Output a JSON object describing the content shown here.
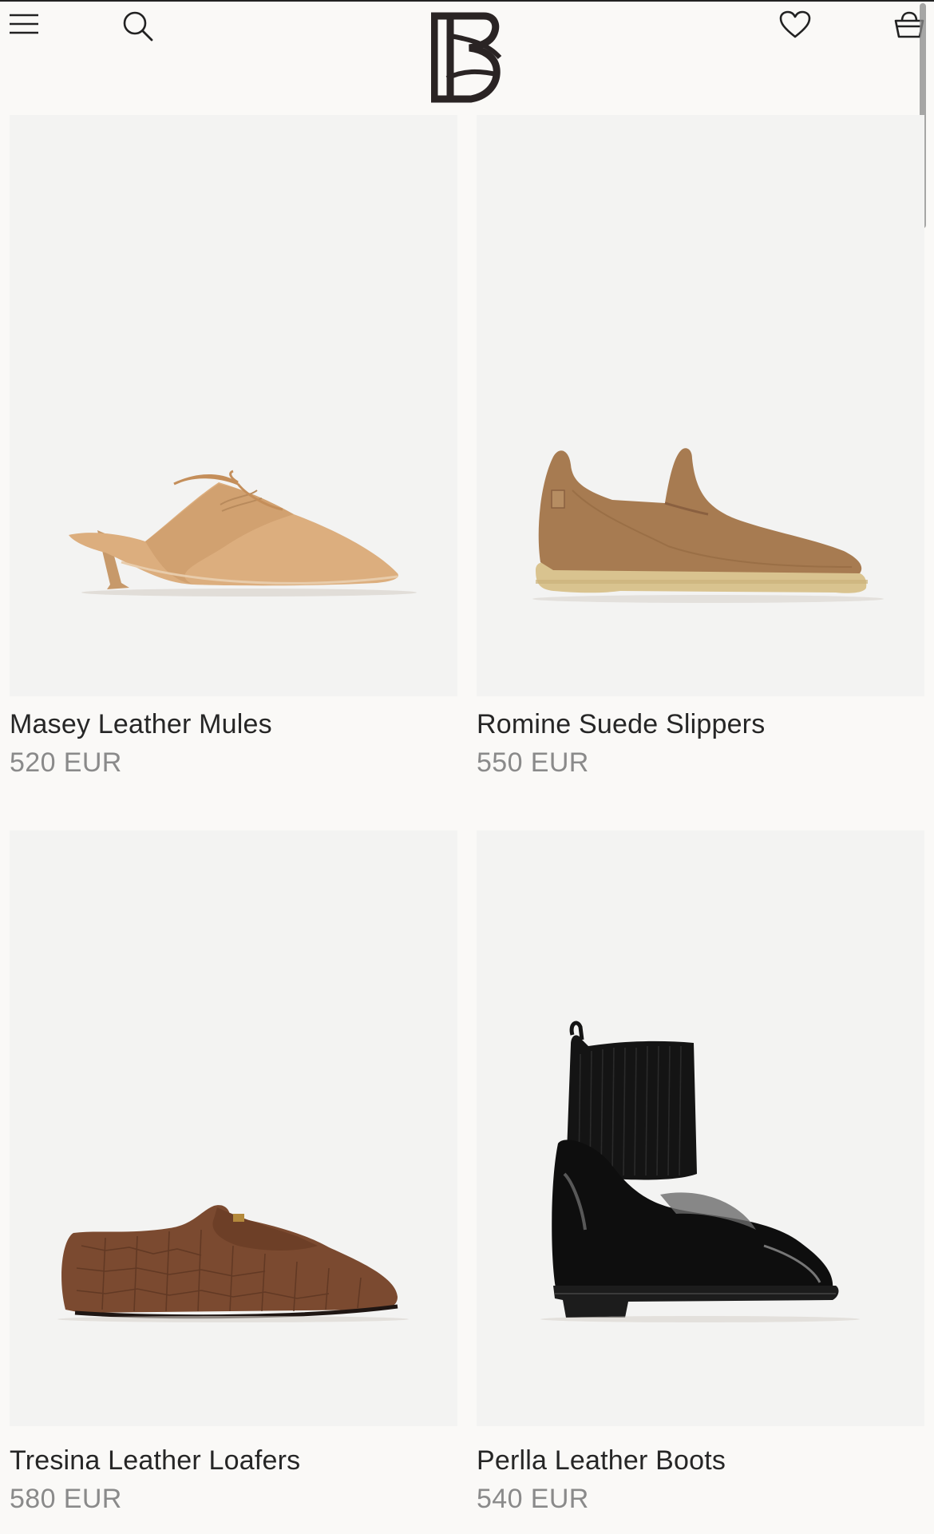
{
  "header": {
    "menu_icon": "hamburger-menu-icon",
    "search_icon": "search-icon",
    "logo": "brand-monogram-logo",
    "wishlist_icon": "heart-icon",
    "bag_icon": "shopping-bag-icon"
  },
  "products": [
    {
      "name": "Masey Leather Mules",
      "price": "520 EUR",
      "image": "tan-leather-kitten-heel-mule"
    },
    {
      "name": "Romine Suede Slippers",
      "price": "550 EUR",
      "image": "brown-suede-slipper-crepe-sole"
    },
    {
      "name": "Tresina Leather Loafers",
      "price": "580 EUR",
      "image": "brown-croc-embossed-loafer"
    },
    {
      "name": "Perlla Leather Boots",
      "price": "540 EUR",
      "image": "black-patent-sock-boot"
    }
  ],
  "colors": {
    "background": "#faf9f7",
    "image_background": "#f3f3f2",
    "text": "#262626",
    "price_text": "#8a8a8a"
  }
}
